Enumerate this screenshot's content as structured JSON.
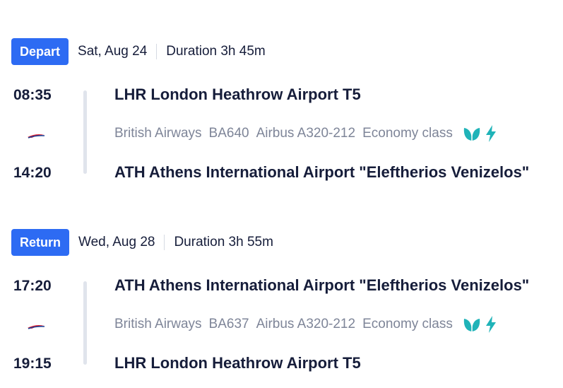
{
  "legs": [
    {
      "badge": "Depart",
      "date": "Sat, Aug 24",
      "duration": "Duration 3h 45m",
      "dep_time": "08:35",
      "arr_time": "14:20",
      "origin": "LHR London Heathrow Airport T5",
      "destination": "ATH Athens International Airport \"Eleftherios Venizelos\"",
      "airline": "British Airways",
      "flight": "BA640",
      "aircraft": "Airbus A320-212",
      "cabin": "Economy class",
      "icons": [
        "leaf-icon",
        "lightning-icon"
      ]
    },
    {
      "badge": "Return",
      "date": "Wed, Aug 28",
      "duration": "Duration 3h 55m",
      "dep_time": "17:20",
      "arr_time": "19:15",
      "origin": "ATH Athens International Airport \"Eleftherios Venizelos\"",
      "destination": "LHR London Heathrow Airport T5",
      "airline": "British Airways",
      "flight": "BA637",
      "aircraft": "Airbus A320-212",
      "cabin": "Economy class",
      "icons": [
        "leaf-icon",
        "lightning-icon"
      ]
    }
  ],
  "colors": {
    "badge": "#2d6bf3",
    "text": "#161d3a",
    "muted": "#7e8598",
    "amenity": "#1fb3b8",
    "timeline": "#e0e4ec"
  }
}
